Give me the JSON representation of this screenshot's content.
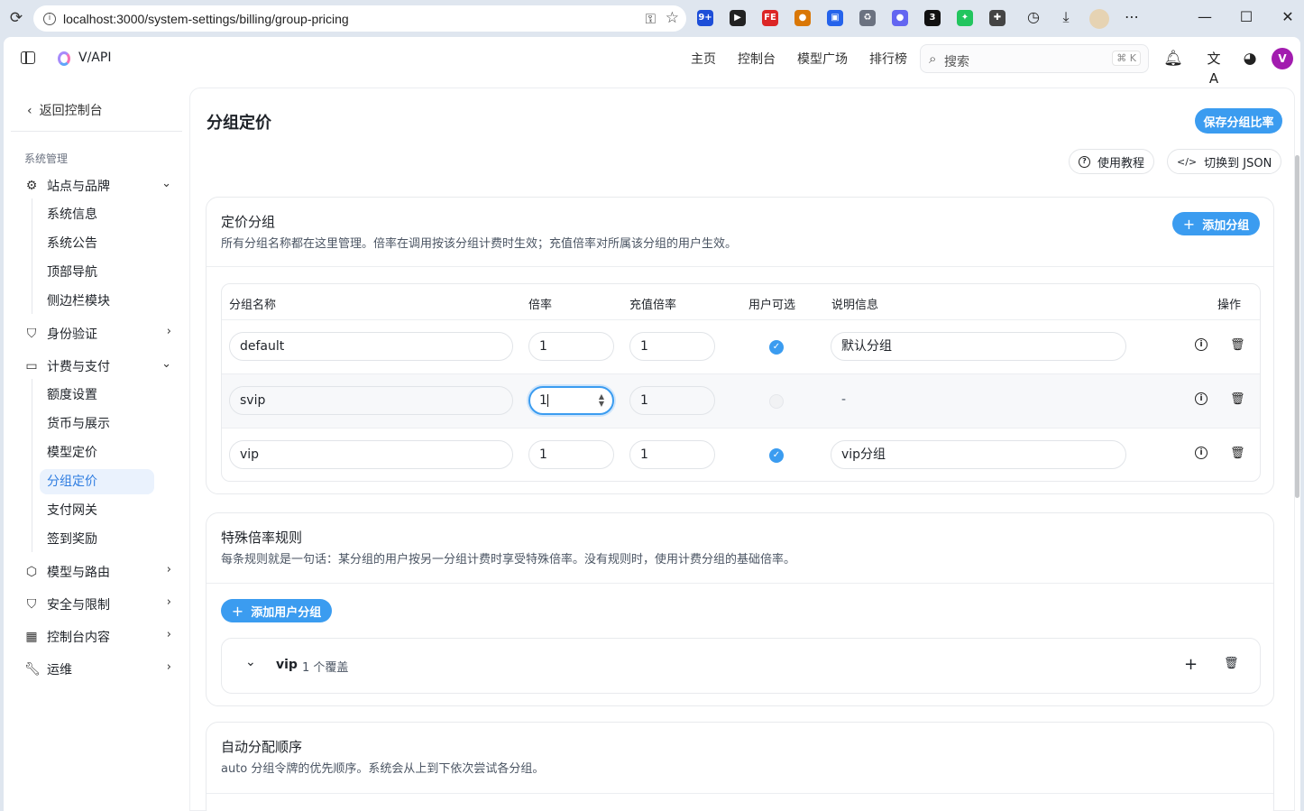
{
  "browser": {
    "url": "localhost:3000/system-settings/billing/group-pricing",
    "extensions": [
      {
        "name": "ext-1-icon",
        "color": "#1d4ed8",
        "label": "9+"
      },
      {
        "name": "ext-2-icon",
        "color": "#222222",
        "label": "▶"
      },
      {
        "name": "ext-3-icon",
        "color": "#dc2626",
        "label": "FE"
      },
      {
        "name": "cookie-icon",
        "color": "#d97706",
        "label": "●"
      },
      {
        "name": "ext-5-icon",
        "color": "#2563eb",
        "label": "▣"
      },
      {
        "name": "recycle-icon",
        "color": "#6b7280",
        "label": "♻"
      },
      {
        "name": "ext-7-icon",
        "color": "#6366f1",
        "label": "●"
      },
      {
        "name": "ext-8-icon",
        "color": "#111111",
        "label": "3"
      },
      {
        "name": "puzzle-green-icon",
        "color": "#22c55e",
        "label": "✦"
      },
      {
        "name": "extensions-icon",
        "color": "#444444",
        "label": "✚"
      }
    ]
  },
  "header": {
    "brand": "V/API",
    "nav": [
      "主页",
      "控制台",
      "模型广场",
      "排行榜"
    ],
    "search_placeholder": "搜索",
    "search_shortcut": "⌘ K",
    "avatar_letter": "V"
  },
  "sidebar": {
    "back_label": "返回控制台",
    "section_label": "系统管理",
    "groups": {
      "site": "站点与品牌",
      "site_items": [
        "系统信息",
        "系统公告",
        "顶部导航",
        "侧边栏模块"
      ],
      "auth": "身份验证",
      "billing": "计费与支付",
      "billing_items": [
        "额度设置",
        "货币与展示",
        "模型定价",
        "分组定价",
        "支付网关",
        "签到奖励"
      ],
      "models": "模型与路由",
      "security": "安全与限制",
      "console": "控制台内容",
      "ops": "运维"
    }
  },
  "main": {
    "title": "分组定价",
    "save_button": "保存分组比率",
    "tutorial_button": "使用教程",
    "json_button": "切换到 JSON",
    "pricing_groups": {
      "title": "定价分组",
      "description": "所有分组名称都在这里管理。倍率在调用按该分组计费时生效；充值倍率对所属该分组的用户生效。",
      "add_button": "添加分组",
      "columns": [
        "分组名称",
        "倍率",
        "充值倍率",
        "用户可选",
        "说明信息",
        "操作"
      ],
      "rows": [
        {
          "name": "default",
          "ratio": "1",
          "topup_ratio": "1",
          "selectable": true,
          "description": "默认分组"
        },
        {
          "name": "svip",
          "ratio": "1",
          "topup_ratio": "1",
          "selectable": false,
          "description": "-"
        },
        {
          "name": "vip",
          "ratio": "1",
          "topup_ratio": "1",
          "selectable": true,
          "description": "vip分组"
        }
      ]
    },
    "special_rules": {
      "title": "特殊倍率规则",
      "description": "每条规则就是一句话：某分组的用户按另一分组计费时享受特殊倍率。没有规则时，使用计费分组的基础倍率。",
      "add_button": "添加用户分组",
      "rule_group": "vip",
      "rule_count": "1 个覆盖"
    },
    "auto_order": {
      "title": "自动分配顺序",
      "description": "auto 分组令牌的优先顺序。系统会从上到下依次尝试各分组。"
    }
  }
}
